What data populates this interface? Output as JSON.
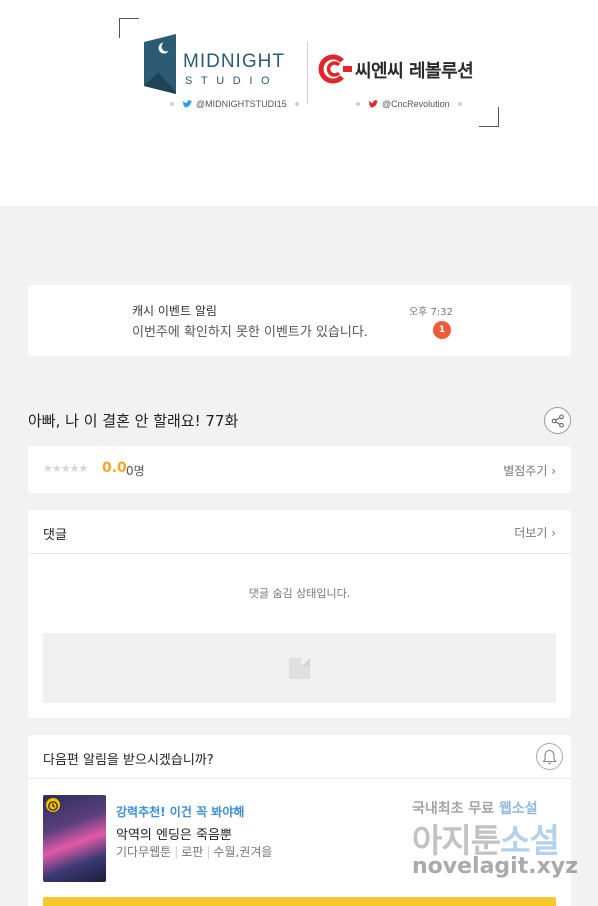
{
  "banner": {
    "midnight_word": "MIDNIGHT",
    "midnight_sub": "STUDIO",
    "midnight_handle": "@MIDNIGHTSTUDI15",
    "cnc_word": "씨엔씨 레볼루션",
    "cnc_handle": "@CncRevolution",
    "colors": {
      "midnight": "#2c5c74",
      "cnc_red": "#e0252b",
      "twitter": "#1da1f2"
    }
  },
  "notice": {
    "title": "캐시 이벤트 알림",
    "message": "이번주에 확인하지 못한 이벤트가 있습니다.",
    "time": "오후 7:32",
    "badge_count": "1",
    "badge_color": "#f05a3a"
  },
  "episode": {
    "title": "아빠, 나 이 결혼 안 할래요! 77화",
    "share_icon": "share-icon"
  },
  "rating": {
    "stars_text": "★★★★★",
    "score": "0.0",
    "voters": "0명",
    "rate_link": "별점주기 ›"
  },
  "comments": {
    "title": "댓글",
    "more": "더보기 ›",
    "hidden_message": "댓글 숨김 상태입니다."
  },
  "subscribe": {
    "question": "다음편 알림을 받으시겠습니까?",
    "recommend_tag": "강력추천! 이건 꼭 봐야해",
    "recommend_title": "악역의 엔딩은 죽음뿐",
    "meta": [
      "기다무웹툰",
      "로판",
      "수월,권겨을"
    ],
    "accent_color": "#f7c82c"
  },
  "watermark": {
    "line1_a": "국내최초 무료 ",
    "line1_b": "웹소설",
    "line2_a": "아지툰",
    "line2_b": "소설",
    "line3": "novelagit.xyz"
  }
}
